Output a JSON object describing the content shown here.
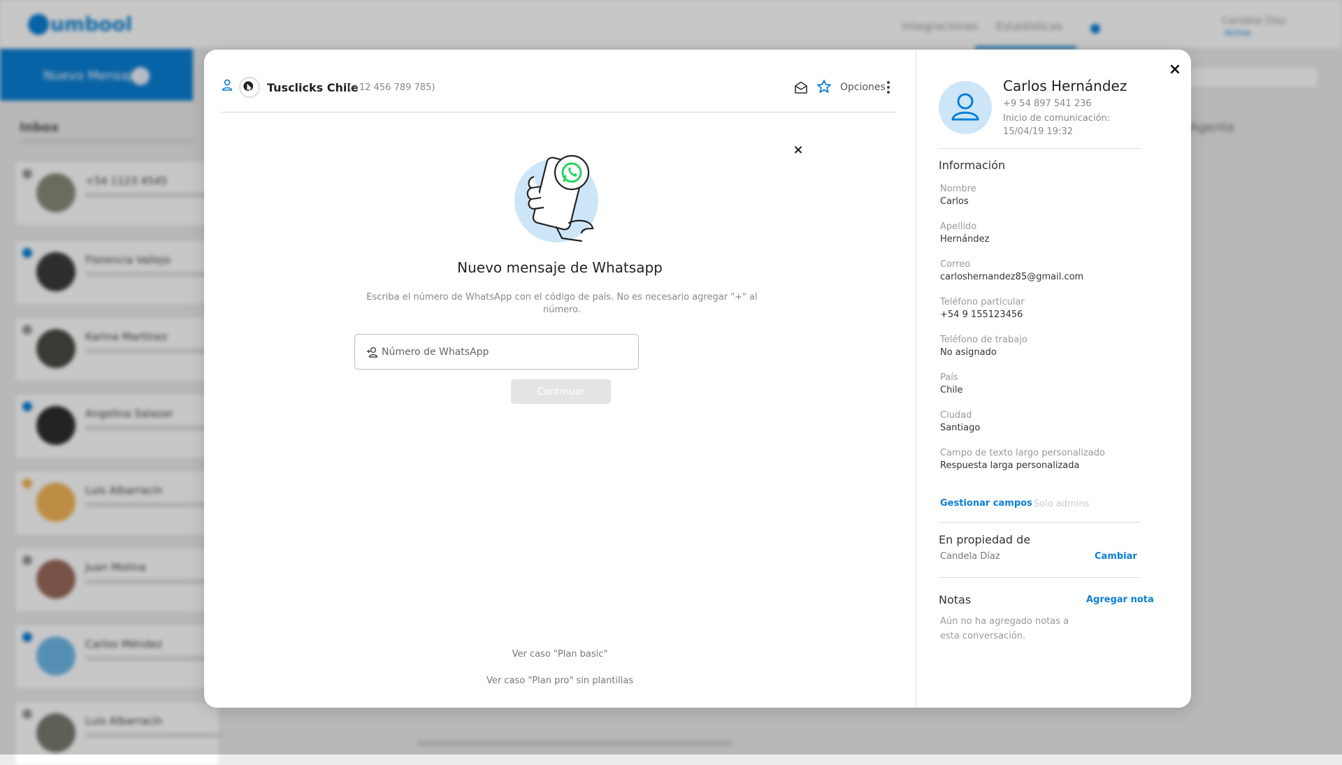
{
  "background": {
    "logo": "umbool",
    "nav": [
      "Integraciones",
      "Estadísticas"
    ],
    "user_name": "Candela Díaz",
    "user_sub": "Activa",
    "new_message_label": "Nuevo Mensaje",
    "inbox_title": "Inbox",
    "right_label": "Agente",
    "conversations": [
      {
        "name": "+54 1123 4545"
      },
      {
        "name": "Florencia Vallejo"
      },
      {
        "name": "Karina Martinez"
      },
      {
        "name": "Angelina Salazar"
      },
      {
        "name": "Luis Albarracín"
      },
      {
        "name": "Juan Molina"
      },
      {
        "name": "Carlos Méndez"
      },
      {
        "name": "Luis Albarracín"
      }
    ]
  },
  "conversation_header": {
    "account_name": "Tusclicks Chile",
    "account_phone": "(+12 456 789 785)",
    "options_label": "Opciones"
  },
  "new_message": {
    "title": "Nuevo mensaje de Whatsapp",
    "description": "Escriba el número de WhatsApp con el código de país. No es necesario agregar \"+\" al número.",
    "input_placeholder": "Número de WhatsApp",
    "input_value": "",
    "continue_label": "Continuar",
    "close_glyph": "×"
  },
  "footer_links": {
    "basic": "Ver caso \"Plan basic\"",
    "pro": "Ver caso \"Plan pro\" sin plantillas"
  },
  "contact": {
    "close_glyph": "×",
    "name": "Carlos Hernández",
    "phone": "+9 54 897 541 236",
    "since_label": "Inicio de comunicación: 15/04/19 19:32",
    "info_title": "Información",
    "fields": [
      {
        "label": "Nombre",
        "value": "Carlos"
      },
      {
        "label": "Apellido",
        "value": "Hernández"
      },
      {
        "label": "Correo",
        "value": "carloshernandez85@gmail.com"
      },
      {
        "label": "Teléfono particular",
        "value": "+54 9 155123456"
      },
      {
        "label": "Teléfono de trabajo",
        "value": "No asignado"
      },
      {
        "label": "País",
        "value": "Chile"
      },
      {
        "label": "Ciudad",
        "value": "Santiago"
      },
      {
        "label": "Campo de texto largo personalizado",
        "value": "Respuesta larga personalizada"
      }
    ],
    "manage_fields_label": "Gestionar campos",
    "admins_only_label": "Solo admins",
    "owner_title": "En propiedad de",
    "owner_name": "Candela Díaz",
    "change_label": "Cambiar",
    "notes_title": "Notas",
    "add_note_label": "Agregar nota",
    "notes_empty": "Aún no ha agregado notas a esta conversación."
  },
  "colors": {
    "accent": "#0a7fd4",
    "whatsapp_green": "#25d366",
    "avatar_bg": "#cde6f7"
  }
}
